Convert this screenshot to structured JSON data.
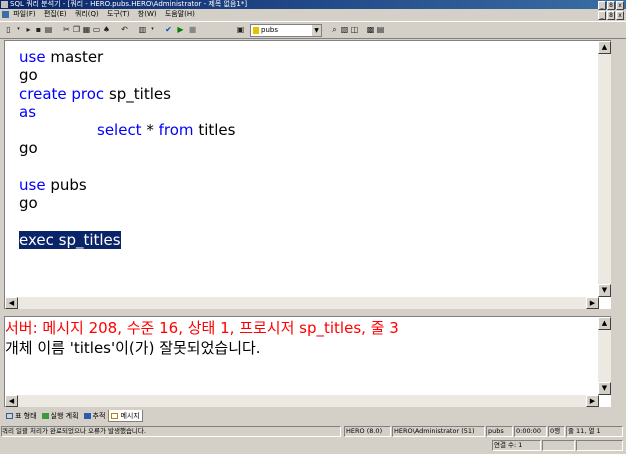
{
  "window": {
    "title": "SQL 쿼리 분석기 - [쿼리 - HERO.pubs.HERO\\Administrator - 제목 없음1*]",
    "controls": [
      "_",
      "8",
      "x"
    ]
  },
  "menubar": {
    "items": [
      "파일(F)",
      "편집(E)",
      "쿼리(Q)",
      "도구(T)",
      "창(W)",
      "도움말(H)"
    ],
    "mdi_controls": [
      "_",
      "8",
      "x"
    ]
  },
  "toolbar": {
    "buttons": [
      {
        "name": "new-query-button",
        "glyph": "▯"
      },
      {
        "name": "open-button",
        "glyph": "▸"
      },
      {
        "name": "save-button",
        "glyph": "▪"
      },
      {
        "name": "load-script-button",
        "glyph": "▤"
      },
      {
        "name": "cut-button",
        "glyph": "✂"
      },
      {
        "name": "copy-button",
        "glyph": "❐"
      },
      {
        "name": "paste-button",
        "glyph": "▦"
      },
      {
        "name": "clear-window-button",
        "glyph": "▭"
      },
      {
        "name": "find-button",
        "glyph": "♠"
      },
      {
        "name": "undo-button",
        "glyph": "↶"
      },
      {
        "name": "results-mode-button",
        "glyph": "▥"
      },
      {
        "name": "parse-button",
        "glyph": "✔"
      },
      {
        "name": "execute-button",
        "glyph": "▶"
      },
      {
        "name": "cancel-execution-button",
        "glyph": "■"
      },
      {
        "name": "object-browser-button",
        "glyph": "▣"
      },
      {
        "name": "object-search-button",
        "glyph": "⌕"
      },
      {
        "name": "show-plan-button",
        "glyph": "▧"
      },
      {
        "name": "show-results-pane-button",
        "glyph": "◫"
      },
      {
        "name": "options-button",
        "glyph": "▩"
      }
    ],
    "database": "pubs"
  },
  "editor": {
    "lines": [
      [
        {
          "t": "use",
          "k": true
        },
        {
          "t": " master"
        }
      ],
      [
        {
          "t": "go"
        }
      ],
      [
        {
          "t": "create proc",
          "k": true
        },
        {
          "t": " sp_titles"
        }
      ],
      [
        {
          "t": "as",
          "k": true
        }
      ],
      [
        {
          "t": "\t"
        },
        {
          "t": "select",
          "k": true
        },
        {
          "t": " * "
        },
        {
          "t": "from",
          "k": true
        },
        {
          "t": " titles"
        }
      ],
      [
        {
          "t": "go"
        }
      ],
      [
        {
          "t": ""
        }
      ],
      [
        {
          "t": "use",
          "k": true
        },
        {
          "t": " pubs"
        }
      ],
      [
        {
          "t": "go"
        }
      ],
      [
        {
          "t": ""
        }
      ],
      [
        {
          "t": "exec sp_titles",
          "h": true
        }
      ]
    ]
  },
  "results": {
    "error_line": "서버: 메시지 208, 수준 16, 상태 1, 프로시저 sp_titles, 줄 3",
    "detail_line": "개체 이름 'titles'이(가) 잘못되었습니다."
  },
  "tabs": [
    {
      "label": "표 형태",
      "active": false,
      "color": "#2a5db0"
    },
    {
      "label": "실행 계획",
      "active": false,
      "color": "#3a9a3a"
    },
    {
      "label": "추적",
      "active": false,
      "color": "#2a5db0"
    },
    {
      "label": "메시지",
      "active": true,
      "color": "#c08000"
    }
  ],
  "statusbar": {
    "message": "쿼리 일괄 처리가 완료되었으나 오류가 발생했습니다.",
    "server": "HERO (8.0)",
    "user": "HERO\\Administrator (51)",
    "db": "pubs",
    "time": "0:00:00",
    "rows": "0행",
    "position": "줄 11, 열 1",
    "connections": "연결 수: 1"
  },
  "colors": {
    "keyword": "#0000ff",
    "selection": "#0a246a",
    "error_text": "#ff0000"
  }
}
